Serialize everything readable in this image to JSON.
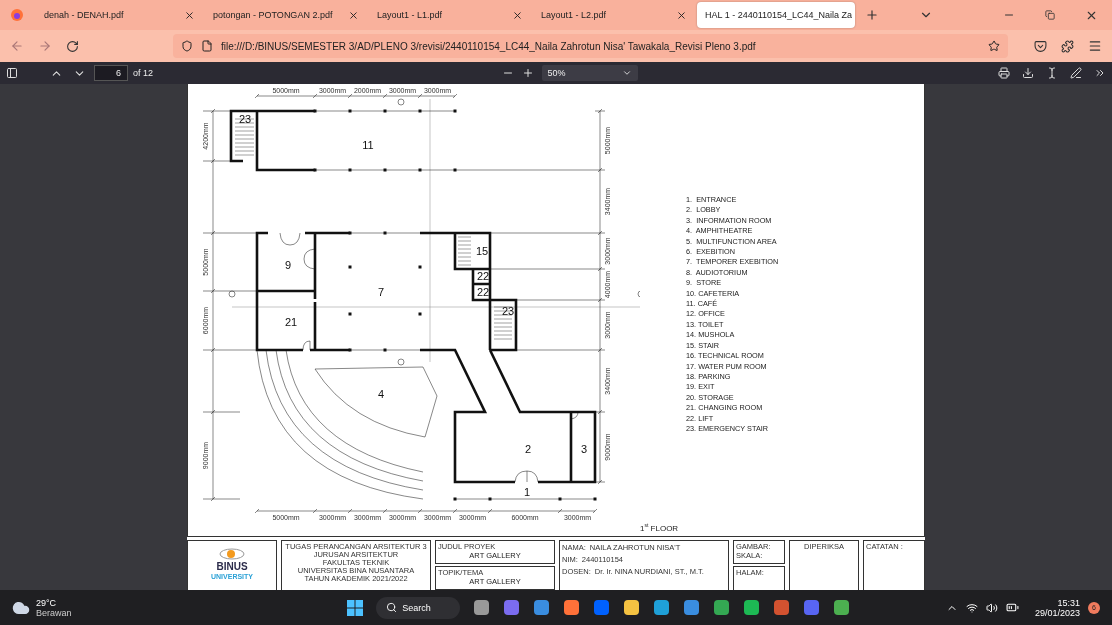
{
  "browser": {
    "tabs": [
      {
        "title": "denah - DENAH.pdf",
        "selected": false
      },
      {
        "title": "potongan - POTONGAN 2.pdf",
        "selected": false
      },
      {
        "title": "Layout1 - L1.pdf",
        "selected": false
      },
      {
        "title": "Layout1 - L2.pdf",
        "selected": false
      },
      {
        "title": "HAL 1 - 2440110154_LC44_Naila Za",
        "selected": true
      }
    ],
    "url": "file:///D:/BINUS/SEMESTER 3/AD/PLENO 3/revisi/2440110154_LC44_Naila Zahrotun Nisa' Tawakala_Revisi Pleno 3.pdf"
  },
  "pdf_toolbar": {
    "page": "6",
    "page_count": "of 12",
    "zoom": "50%"
  },
  "document": {
    "plan": {
      "rooms": [
        "23",
        "11",
        "9",
        "7",
        "15",
        "22",
        "22",
        "23",
        "21",
        "4",
        "2",
        "3",
        "1"
      ],
      "dims_top": [
        "5000mm",
        "3000mm",
        "2000mm",
        "3000mm",
        "3000mm"
      ],
      "dims_bottom": [
        "5000mm",
        "3000mm",
        "3000mm",
        "3000mm",
        "3000mm",
        "3000mm",
        "6000mm",
        "3000mm"
      ],
      "dims_left": [
        "4200mm",
        "5000mm",
        "6000mm",
        "9000mm"
      ],
      "dims_right": [
        "5000mm",
        "3400mm",
        "3000mm",
        "4000mm",
        "3000mm",
        "3400mm",
        "9000mm"
      ]
    },
    "legend": [
      "1.  ENTRANCE",
      "2.  LOBBY",
      "3.  INFORMATION ROOM",
      "4.  AMPHITHEATRE",
      "5.  MULTIFUNCTION AREA",
      "6.  EXEBITION",
      "7.  TEMPORER EXEBITION",
      "8.  AUDIOTORIUM",
      "9.  STORE",
      "10. CAFETERIA",
      "11. CAFÉ",
      "12. OFFICE",
      "13. TOILET",
      "14. MUSHOLA",
      "15. STAIR",
      "16. TECHNICAL ROOM",
      "17. WATER PUM ROOM",
      "18. PARKING",
      "19. EXIT",
      "20. STORAGE",
      "21. CHANGING ROOM",
      "22. LIFT",
      "23. EMERGENCY STAIR"
    ],
    "floor_title": "1$^{st}$ FLOOR",
    "title_block": {
      "logo": [
        "BINUS",
        "UNIVERSITY"
      ],
      "institution": [
        "TUGAS PERANCANGAN ARSITEKTUR 3",
        "JURUSAN ARSITEKTUR",
        "FAKULTAS TEKNIK",
        "UNIVERSITAS BINA NUSANTARA",
        "TAHUN AKADEMIK 2021/2022"
      ],
      "project": [
        {
          "label": "JUDUL PROYEK",
          "value": "ART GALLERY"
        },
        {
          "label": "TOPIK/TEMA",
          "value": "ART GALLERY"
        }
      ],
      "student": [
        {
          "label": "NAMA:",
          "value": "NAILA ZAHROTUN NISA'T"
        },
        {
          "label": "NIM:",
          "value": "2440110154"
        },
        {
          "label": "DOSEN:",
          "value": "Dr. Ir. NINA NURDIANI, ST., M.T."
        }
      ],
      "drawing": [
        "GAMBAR:",
        "SKALA:",
        "HALAM:"
      ],
      "checked_by": "DIPERIKSA",
      "notes": "CATATAN :"
    }
  },
  "taskbar": {
    "weather": {
      "temp": "29°C",
      "condition": "Berawan"
    },
    "search": "Search",
    "time": "15:31",
    "date": "29/01/2023",
    "notifications": "6"
  }
}
